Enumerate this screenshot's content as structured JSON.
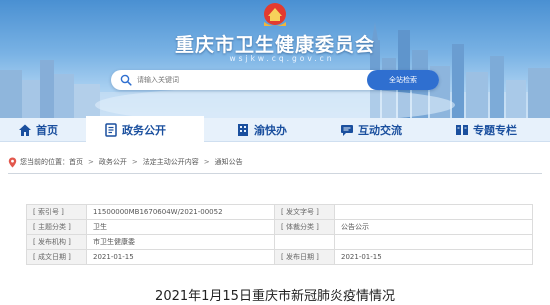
{
  "header": {
    "site_title": "重庆市卫生健康委员会",
    "site_domain": "wsjkw.cq.gov.cn",
    "search": {
      "placeholder": "请输入关键词",
      "button_label": "全站检索"
    }
  },
  "nav": {
    "items": [
      {
        "label": "首页",
        "icon": "home-icon"
      },
      {
        "label": "政务公开",
        "icon": "document-icon",
        "active": true
      },
      {
        "label": "渝快办",
        "icon": "building-icon"
      },
      {
        "label": "互动交流",
        "icon": "chat-icon"
      },
      {
        "label": "专题专栏",
        "icon": "columns-icon"
      }
    ]
  },
  "breadcrumb": {
    "prefix": "您当前的位置：",
    "items": [
      "首页",
      "政务公开",
      "法定主动公开内容",
      "通知公告"
    ],
    "separator": ">"
  },
  "meta_table": {
    "rows": [
      [
        "[ 索引号 ]",
        "11500000MB1670604W/2021-00052",
        "[ 发文字号 ]",
        ""
      ],
      [
        "[ 主题分类 ]",
        "卫生",
        "[ 体裁分类 ]",
        "公告公示"
      ],
      [
        "[ 发布机构 ]",
        "市卫生健康委",
        "",
        ""
      ],
      [
        "[ 成文日期 ]",
        "2021-01-15",
        "[ 发布日期 ]",
        "2021-01-15"
      ]
    ]
  },
  "article": {
    "title": "2021年1月15日重庆市新冠肺炎疫情情况"
  },
  "colors": {
    "brand_blue": "#1a4f9e",
    "search_button": "#2f6fd0",
    "nav_bg": "#e7f1fb"
  }
}
